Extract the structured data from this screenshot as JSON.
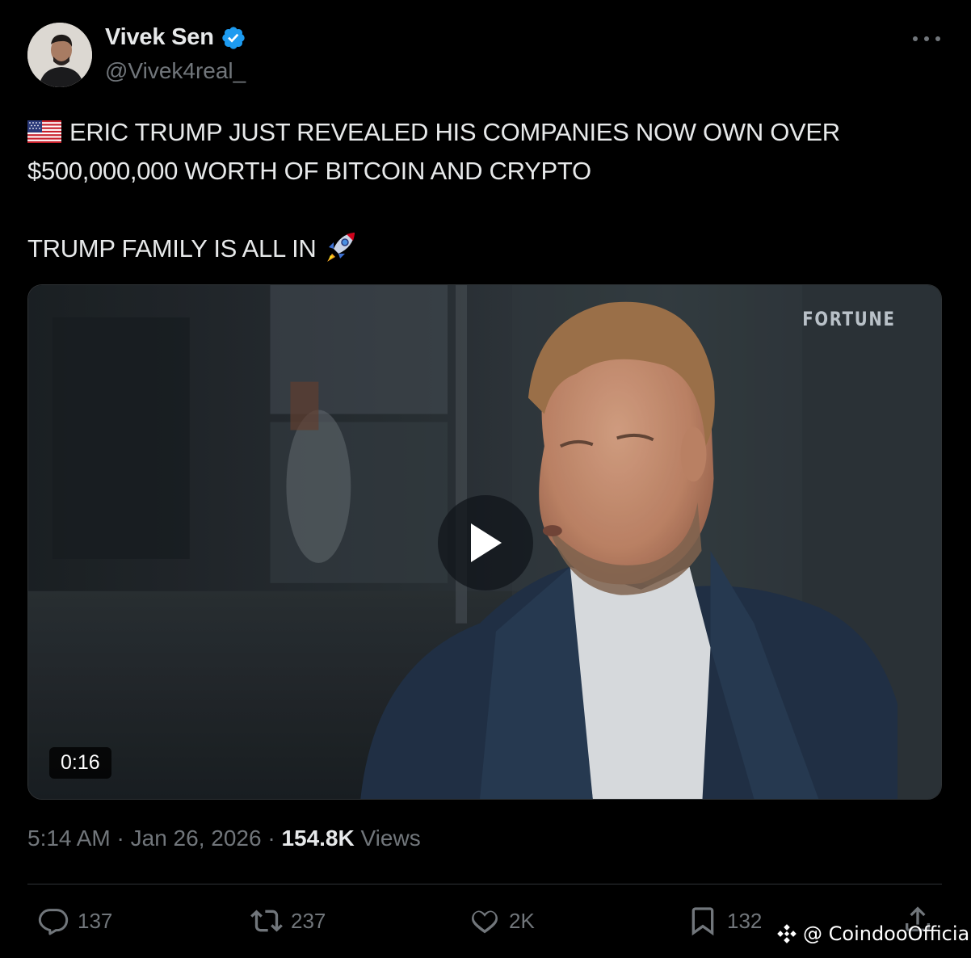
{
  "author": {
    "display_name": "Vivek Sen",
    "handle": "@Vivek4real_",
    "verified": true,
    "avatar_icon": "profile-photo"
  },
  "tweet": {
    "line1": "ERIC TRUMP JUST REVEALED HIS COMPANIES NOW OWN OVER",
    "line2": "$500,000,000 WORTH OF BITCOIN AND CRYPTO",
    "line3": "TRUMP FAMILY IS ALL IN",
    "leading_emoji": "us-flag",
    "trailing_emoji": "rocket"
  },
  "media": {
    "watermark": "FORTUNE",
    "duration": "0:16",
    "play_icon": "play-icon"
  },
  "meta": {
    "time": "5:14 AM",
    "separator": "·",
    "date": "Jan 26, 2026",
    "views_count": "154.8K",
    "views_label": "Views"
  },
  "actions": {
    "replies": "137",
    "reposts": "237",
    "likes": "2K",
    "bookmarks": "132"
  },
  "overlay": {
    "text": "@ CoindooOfficial"
  },
  "colors": {
    "background": "#000000",
    "primary_text": "#e7e9ea",
    "secondary_text": "#71767b",
    "verified_blue": "#1d9bf0",
    "divider": "#2f3336"
  }
}
